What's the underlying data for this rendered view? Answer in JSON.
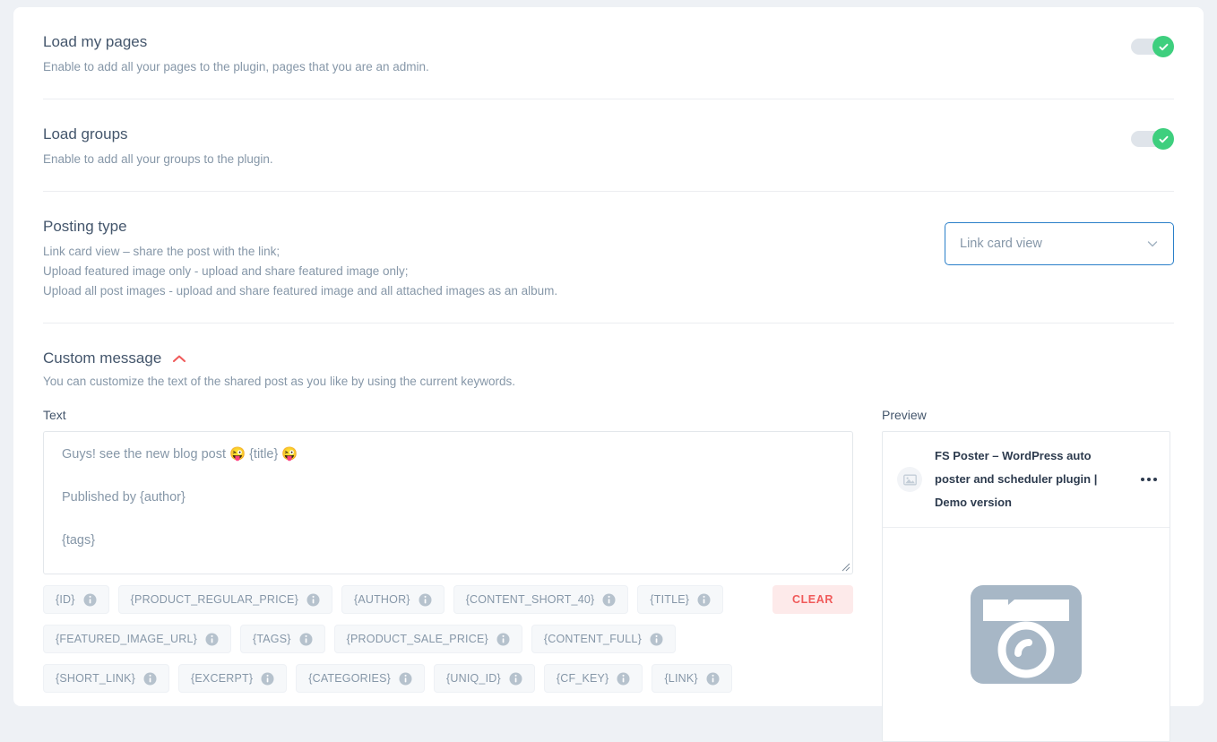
{
  "settings": [
    {
      "name": "load-my-pages",
      "title": "Load my pages",
      "desc": "Enable to add all your pages to the plugin, pages that you are an admin.",
      "toggle_on": true
    },
    {
      "name": "load-groups",
      "title": "Load groups",
      "desc": "Enable to add all your groups to the plugin.",
      "toggle_on": true
    }
  ],
  "posting_type": {
    "title": "Posting type",
    "desc_lines": [
      "Link card view – share the post with the link;",
      "Upload featured image only - upload and share featured image only;",
      "Upload all post images - upload and share featured image and all attached images as an album."
    ],
    "selected": "Link card view",
    "options": [
      "Link card view",
      "Upload featured image only",
      "Upload all post images"
    ],
    "border_color": "#2a7fc9",
    "chevron_icon": "chevron-down-icon"
  },
  "custom_message": {
    "title": "Custom message",
    "collapse_icon": "chevron-up-icon",
    "collapse_icon_color": "#f05a5a",
    "desc": "You can customize the text of the shared post as you like by using the current keywords.",
    "text_label": "Text",
    "textarea_lines": [
      "Guys! see the new blog post 😜 {title} 😜",
      "Published by {author}",
      "{tags}"
    ],
    "clear_label": "CLEAR",
    "clear_bg": "#fdeaea",
    "clear_color": "#f05a5a",
    "chip_rows": [
      [
        {
          "label": "{ID}",
          "info": "info-icon"
        },
        {
          "label": "{PRODUCT_REGULAR_PRICE}",
          "info": "info-icon"
        },
        {
          "label": "{AUTHOR}",
          "info": "info-icon"
        },
        {
          "label": "{CONTENT_SHORT_40}",
          "info": "info-icon"
        },
        {
          "label": "{TITLE}",
          "info": "info-icon"
        }
      ],
      [
        {
          "label": "{FEATURED_IMAGE_URL}",
          "info": "info-icon"
        },
        {
          "label": "{TAGS}",
          "info": "info-icon"
        },
        {
          "label": "{PRODUCT_SALE_PRICE}",
          "info": "info-icon"
        },
        {
          "label": "{CONTENT_FULL}",
          "info": "info-icon"
        }
      ],
      [
        {
          "label": "{SHORT_LINK}",
          "info": "info-icon"
        },
        {
          "label": "{EXCERPT}",
          "info": "info-icon"
        },
        {
          "label": "{CATEGORIES}",
          "info": "info-icon"
        },
        {
          "label": "{UNIQ_ID}",
          "info": "info-icon"
        },
        {
          "label": "{CF_KEY}",
          "info": "info-icon"
        },
        {
          "label": "{LINK}",
          "info": "info-icon"
        }
      ]
    ]
  },
  "preview": {
    "label": "Preview",
    "card_title": "FS Poster – WordPress auto poster and scheduler plugin | Demo version",
    "thumb_icon": "image-placeholder-icon",
    "more_icon": "more-options-icon",
    "media_icon": "camera-placeholder-icon",
    "media_icon_color": "#a7b7c6"
  }
}
